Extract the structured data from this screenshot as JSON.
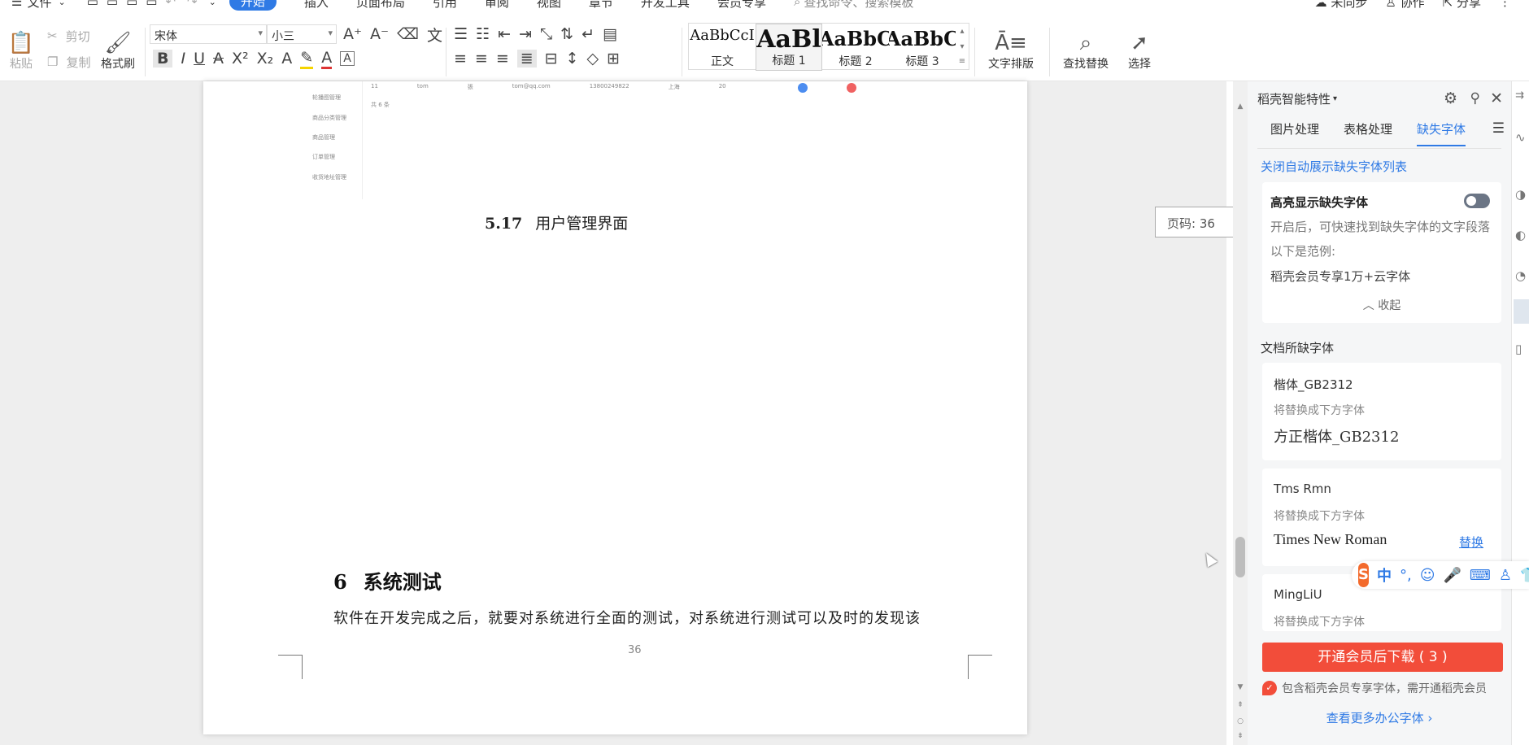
{
  "menu": {
    "file_label": "文件",
    "tabs": [
      "开始",
      "插入",
      "页面布局",
      "引用",
      "审阅",
      "视图",
      "章节",
      "开发工具",
      "会员专享"
    ],
    "active_tab": "开始",
    "search_placeholder": "查找命令、搜索模板",
    "sync_label": "未同步",
    "collab_label": "协作",
    "share_label": "分享"
  },
  "ribbon": {
    "paste": "粘贴",
    "cut": "剪切",
    "copy": "复制",
    "format_painter": "格式刷",
    "font_name": "宋体",
    "font_size": "小三",
    "styles": [
      {
        "preview": "AaBbCcI",
        "label": "正文"
      },
      {
        "preview": "AaBl",
        "label": "标题 1"
      },
      {
        "preview": "AaBbC",
        "label": "标题 2"
      },
      {
        "preview": "AaBbC",
        "label": "标题 3"
      }
    ],
    "text_layout": "文字排版",
    "find_replace": "查找替换",
    "select": "选择"
  },
  "document": {
    "screenshot_rows": [
      "11",
      "tom",
      "張",
      "tom@qq.com",
      "13800249822",
      "上海",
      "20"
    ],
    "screenshot_sidebar": [
      "轮播图管理",
      "商品分类管理",
      "商品管理",
      "订单管理",
      "收货地址管理"
    ],
    "screenshot_pager": "共 6 条",
    "caption_num": "5.17",
    "caption_text": "用户管理界面",
    "heading_num": "6",
    "heading_text": "系统测试",
    "paragraph": "软件在开发完成之后，就要对系统进行全面的测试，对系统进行测试可以及时的发现该",
    "page_number": "36"
  },
  "page_badge": "页码: 36",
  "panel": {
    "title": "稻壳智能特性",
    "tabs": [
      "图片处理",
      "表格处理",
      "缺失字体"
    ],
    "active_tab": "缺失字体",
    "close_auto_link": "关闭自动展示缺失字体列表",
    "highlight_title": "高亮显示缺失字体",
    "highlight_desc": "开启后，可快速找到缺失字体的文字段落",
    "example_label": "以下是范例:",
    "example_text": "稻壳会员专享1万+云字体",
    "collapse": "收起",
    "missing_header": "文档所缺字体",
    "fonts": [
      {
        "name": "楷体_GB2312",
        "hint": "将替换成下方字体",
        "replacement": "方正楷体_GB2312",
        "action": ""
      },
      {
        "name": "Tms Rmn",
        "hint": "将替换成下方字体",
        "replacement": "Times New Roman",
        "action": "替换"
      },
      {
        "name": "MingLiU",
        "hint": "将替换成下方字体",
        "replacement": "",
        "action": ""
      }
    ],
    "download_button": "开通会员后下载 ( 3 )",
    "notice": "包含稻壳会员专享字体，需开通稻壳会员",
    "more_link": "查看更多办公字体"
  },
  "ime": {
    "lang": "中",
    "punct": "°,"
  },
  "colors": {
    "accent": "#2f7ae5",
    "download": "#f24d3a"
  }
}
